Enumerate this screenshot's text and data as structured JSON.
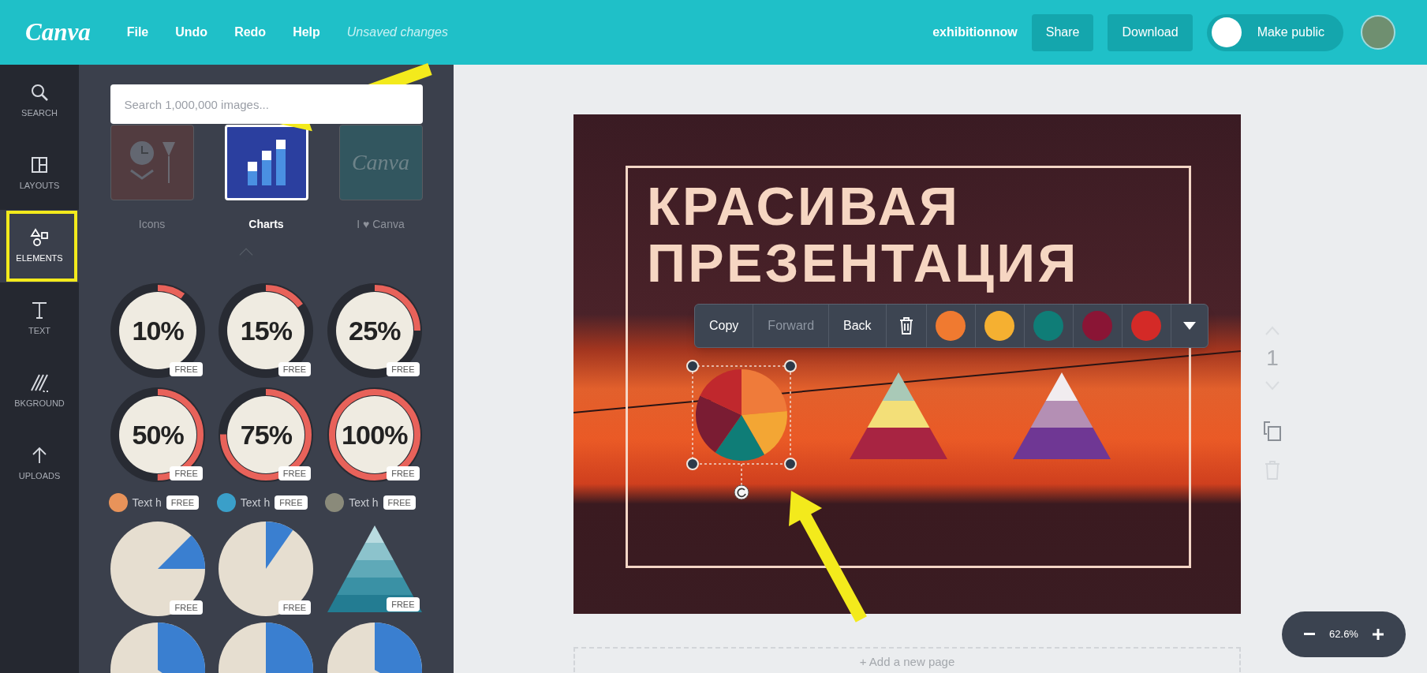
{
  "header": {
    "logo": "Canva",
    "menu": [
      "File",
      "Undo",
      "Redo",
      "Help"
    ],
    "status": "Unsaved changes",
    "team": "exhibitionnow",
    "buttons": [
      "Share",
      "Download"
    ],
    "make_public": {
      "label": "Make public",
      "on": false
    }
  },
  "sidebar": {
    "items": [
      {
        "kind": "search",
        "label": "SEARCH",
        "selected": false
      },
      {
        "kind": "layouts",
        "label": "LAYOUTS",
        "selected": false
      },
      {
        "kind": "elements",
        "label": "ELEMENTS",
        "selected": true
      },
      {
        "kind": "text",
        "label": "TEXT",
        "selected": false
      },
      {
        "kind": "background",
        "label": "BKGROUND",
        "selected": false
      },
      {
        "kind": "uploads",
        "label": "UPLOADS",
        "selected": false
      }
    ]
  },
  "panel": {
    "search": {
      "placeholder": "Search 1,000,000 images..."
    },
    "categories": [
      {
        "kind": "icons",
        "label": "Icons",
        "selected": false
      },
      {
        "kind": "charts",
        "label": "Charts",
        "selected": true
      },
      {
        "kind": "canva",
        "label": "I ♥ Canva",
        "thumb_text": "Canva",
        "selected": false
      }
    ],
    "elements": [
      {
        "kind": "ring",
        "label": "10%",
        "level": 0.1,
        "badge": "FREE"
      },
      {
        "kind": "ring",
        "label": "15%",
        "level": 0.15,
        "badge": "FREE"
      },
      {
        "kind": "ring",
        "label": "25%",
        "level": 0.25,
        "badge": "FREE"
      },
      {
        "kind": "ring",
        "label": "50%",
        "level": 0.5,
        "badge": "FREE"
      },
      {
        "kind": "ring",
        "label": "75%",
        "level": 0.75,
        "badge": "FREE"
      },
      {
        "kind": "ring",
        "label": "100%",
        "level": 1,
        "badge": "FREE"
      },
      {
        "kind": "text",
        "label": "Text h",
        "color": "#e8935a",
        "badge": "FREE"
      },
      {
        "kind": "text",
        "label": "Text h",
        "color": "#3a9fc9",
        "badge": "FREE"
      },
      {
        "kind": "text",
        "label": "Text h",
        "color": "#8a8a7a",
        "badge": "FREE"
      },
      {
        "kind": "pie",
        "badge": "FREE"
      },
      {
        "kind": "pie",
        "badge": "FREE"
      },
      {
        "kind": "pyramid",
        "badge": "FREE"
      },
      {
        "kind": "pie"
      },
      {
        "kind": "pie"
      },
      {
        "kind": "pie"
      }
    ]
  },
  "design": {
    "title_lines": [
      "КРАСИВАЯ",
      "ПРЕЗЕНТАЦИЯ"
    ],
    "toolbar": {
      "actions": [
        {
          "label": "Copy",
          "disabled": false
        },
        {
          "label": "Forward",
          "disabled": true
        },
        {
          "label": "Back",
          "disabled": false
        }
      ],
      "swatches": [
        {
          "color": "#f07a30"
        },
        {
          "color": "#f5b031"
        },
        {
          "color": "#0f7d77"
        },
        {
          "color": "#8a1535"
        },
        {
          "color": "#d42a27"
        }
      ]
    }
  },
  "page_tools": {
    "page_number": "1"
  },
  "zoom": {
    "value": "62.6%"
  },
  "add_page": "+ Add a new page"
}
